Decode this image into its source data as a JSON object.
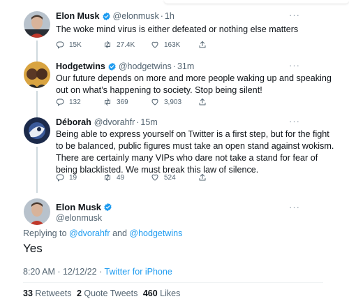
{
  "colors": {
    "accent": "#1d9bf0",
    "secondary_text": "#536471"
  },
  "thread": [
    {
      "name": "Elon Musk",
      "handle": "@elonmusk",
      "separator": "·",
      "time": "1h",
      "verified": true,
      "text": "The woke mind virus is either defeated or nothing else matters",
      "replies": "15K",
      "retweets": "27.4K",
      "likes": "163K"
    },
    {
      "name": "Hodgetwins",
      "handle": "@hodgetwins",
      "separator": "·",
      "time": "31m",
      "verified": true,
      "text_lines": [
        "Our future depends on more and more people waking up and speaking",
        "out on what’s happening to society. Stop being silent!"
      ],
      "replies": "132",
      "retweets": "369",
      "likes": "3,903"
    },
    {
      "name": "Déborah",
      "handle": "@dvorahfr",
      "separator": "·",
      "time": "15m",
      "verified": false,
      "text_lines": [
        "Being able to express yourself on Twitter is a first step, but for the fight",
        "to be balanced, public figures must take an open stand against wokism.",
        "There are certainly many VIPs who dare not take a stand for fear of",
        "being blacklisted. We must break this law of silence."
      ],
      "replies": "19",
      "retweets": "49",
      "likes": "524"
    }
  ],
  "focus": {
    "name": "Elon Musk",
    "handle": "@elonmusk",
    "replying_prefix": "Replying to",
    "reply_to_1": "@dvorahfr",
    "reply_and": "and",
    "reply_to_2": "@hodgetwins",
    "text": "Yes",
    "time": "8:20 AM · 12/12/22 ·",
    "source": "Twitter for iPhone",
    "retweets_count": "33",
    "retweets_label": "Retweets",
    "quotes_count": "2",
    "quotes_label": "Quote Tweets",
    "likes_count": "460",
    "likes_label": "Likes"
  },
  "more_label": "···"
}
